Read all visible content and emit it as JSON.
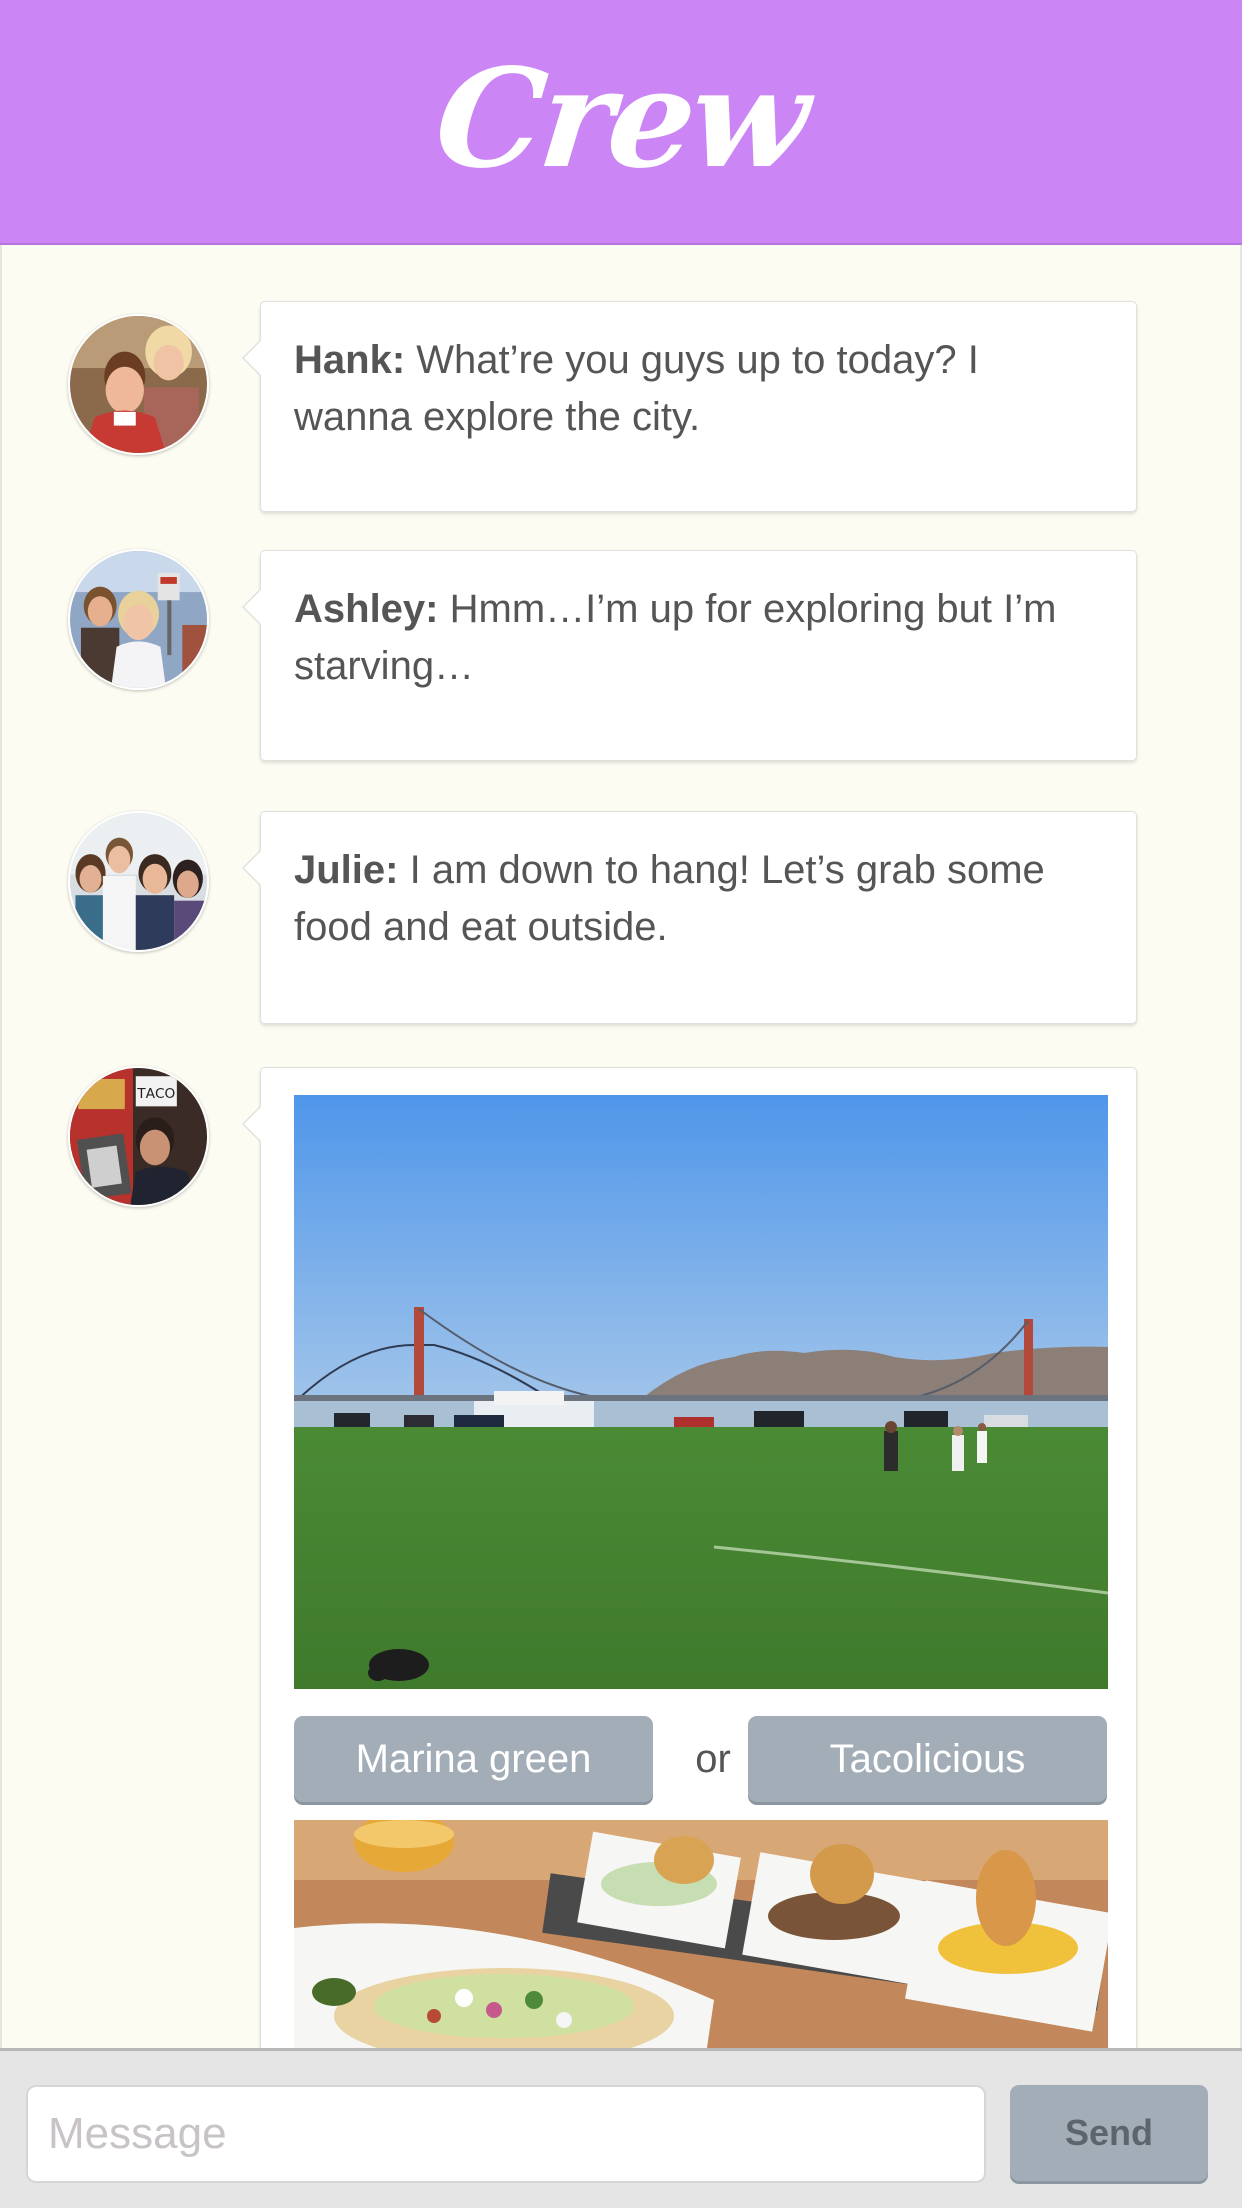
{
  "app": {
    "title": "Crew",
    "accent_color": "#cc85f5",
    "background_color": "#fcfcf3",
    "button_color": "#a3adb7"
  },
  "messages": [
    {
      "author": "Hank:",
      "text": "What’re you guys up to today? I wanna explore the city.",
      "avatar": "hank-avatar"
    },
    {
      "author": "Ashley:",
      "text": "Hmm…I’m up for exploring but I’m starving…",
      "avatar": "ashley-avatar"
    },
    {
      "author": "Julie:",
      "text": "I am down to hang! Let’s grab some food and eat outside.",
      "avatar": "julie-avatar"
    }
  ],
  "suggestion": {
    "avatar": "fourth-user-avatar",
    "photo_1": "marina-green-photo",
    "photo_2": "tacolicious-food-photo",
    "option_1": "Marina green",
    "separator": "or",
    "option_2": "Tacolicious"
  },
  "composer": {
    "placeholder": "Message",
    "value": "",
    "send_label": "Send"
  }
}
